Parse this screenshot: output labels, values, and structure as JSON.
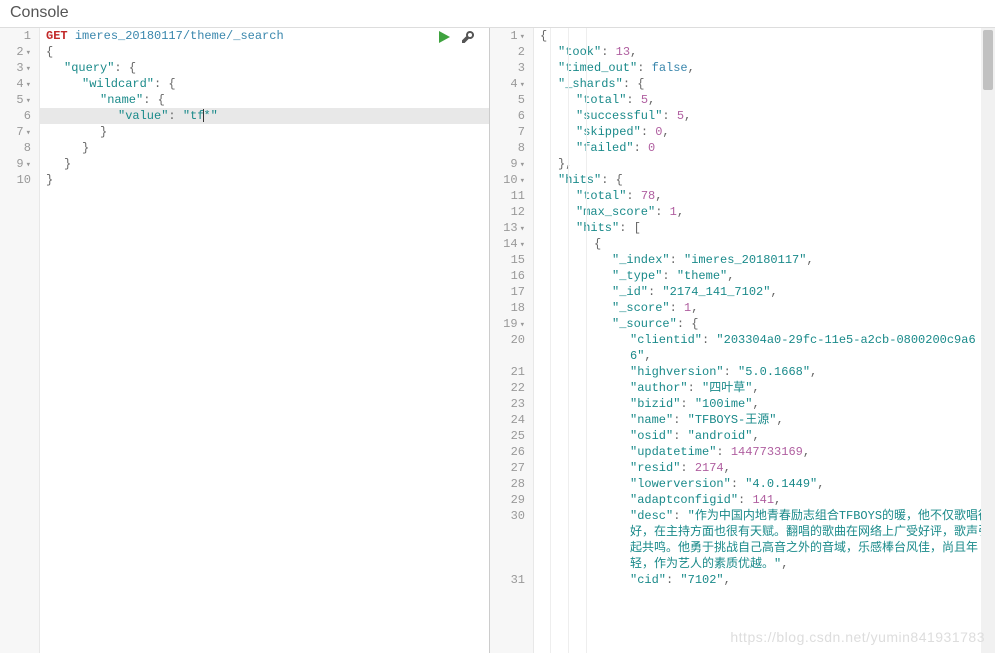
{
  "header": {
    "title": "Console"
  },
  "request": {
    "method": "GET",
    "path": "imeres_20180117/theme/_search",
    "lines": [
      {
        "n": 1,
        "type": "req"
      },
      {
        "n": 2,
        "fold": true,
        "raw": "{"
      },
      {
        "n": 3,
        "fold": true,
        "key": "query",
        "after": ": {"
      },
      {
        "n": 4,
        "fold": true,
        "key": "wildcard",
        "after": ": {"
      },
      {
        "n": 5,
        "fold": true,
        "key": "name",
        "after": ": {"
      },
      {
        "n": 6,
        "active": true,
        "key": "value",
        "val": "tf*",
        "valtype": "str_cursor"
      },
      {
        "n": 7,
        "fold": true,
        "raw": "}"
      },
      {
        "n": 8,
        "raw": "}"
      },
      {
        "n": 9,
        "fold": true,
        "raw": "}"
      },
      {
        "n": 10,
        "raw": "}"
      }
    ]
  },
  "toolbar": {
    "run": "run-button",
    "wrench": "settings-button"
  },
  "response": {
    "lines": [
      {
        "n": 1,
        "fold": true,
        "indent": 0,
        "raw": "{"
      },
      {
        "n": 2,
        "indent": 1,
        "key": "took",
        "val": "13",
        "t": "num"
      },
      {
        "n": 3,
        "indent": 1,
        "key": "timed_out",
        "val": "false",
        "t": "bool"
      },
      {
        "n": 4,
        "fold": true,
        "indent": 1,
        "key": "_shards",
        "after": ": {"
      },
      {
        "n": 5,
        "indent": 2,
        "key": "total",
        "val": "5",
        "t": "num"
      },
      {
        "n": 6,
        "indent": 2,
        "key": "successful",
        "val": "5",
        "t": "num"
      },
      {
        "n": 7,
        "indent": 2,
        "key": "skipped",
        "val": "0",
        "t": "num"
      },
      {
        "n": 8,
        "indent": 2,
        "key": "failed",
        "val": "0",
        "t": "num",
        "nocomma": true
      },
      {
        "n": 9,
        "fold": true,
        "indent": 1,
        "raw": "},"
      },
      {
        "n": 10,
        "fold": true,
        "indent": 1,
        "key": "hits",
        "after": ": {"
      },
      {
        "n": 11,
        "indent": 2,
        "key": "total",
        "val": "78",
        "t": "num"
      },
      {
        "n": 12,
        "indent": 2,
        "key": "max_score",
        "val": "1",
        "t": "num"
      },
      {
        "n": 13,
        "fold": true,
        "indent": 2,
        "key": "hits",
        "after": ": ["
      },
      {
        "n": 14,
        "fold": true,
        "indent": 3,
        "raw": "{"
      },
      {
        "n": 15,
        "indent": 4,
        "key": "_index",
        "val": "imeres_20180117",
        "t": "str"
      },
      {
        "n": 16,
        "indent": 4,
        "key": "_type",
        "val": "theme",
        "t": "str"
      },
      {
        "n": 17,
        "indent": 4,
        "key": "_id",
        "val": "2174_141_7102",
        "t": "str"
      },
      {
        "n": 18,
        "indent": 4,
        "key": "_score",
        "val": "1",
        "t": "num"
      },
      {
        "n": 19,
        "fold": true,
        "indent": 4,
        "key": "_source",
        "after": ": {"
      },
      {
        "n": 20,
        "indent": 5,
        "key": "clientid",
        "val": "203304a0-29fc-11e5-a2cb-0800200c9a66",
        "t": "str",
        "wrap": true
      },
      {
        "n": 21,
        "indent": 5,
        "key": "highversion",
        "val": "5.0.1668",
        "t": "str"
      },
      {
        "n": 22,
        "indent": 5,
        "key": "author",
        "val": "四叶草",
        "t": "str"
      },
      {
        "n": 23,
        "indent": 5,
        "key": "bizid",
        "val": "100ime",
        "t": "str"
      },
      {
        "n": 24,
        "indent": 5,
        "key": "name",
        "val": "TFBOYS-王源",
        "t": "str"
      },
      {
        "n": 25,
        "indent": 5,
        "key": "osid",
        "val": "android",
        "t": "str"
      },
      {
        "n": 26,
        "indent": 5,
        "key": "updatetime",
        "val": "1447733169",
        "t": "num"
      },
      {
        "n": 27,
        "indent": 5,
        "key": "resid",
        "val": "2174",
        "t": "num"
      },
      {
        "n": 28,
        "indent": 5,
        "key": "lowerversion",
        "val": "4.0.1449",
        "t": "str"
      },
      {
        "n": 29,
        "indent": 5,
        "key": "adaptconfigid",
        "val": "141",
        "t": "num"
      },
      {
        "n": 30,
        "indent": 5,
        "key": "desc",
        "val": "作为中国内地青春励志组合TFBOYS的暖，他不仅歌唱得好，在主持方面也很有天赋。翻唱的歌曲在网络上广受好评，歌声引起共鸣。他勇于挑战自己高音之外的音域，乐感棒台风佳，尚且年轻，作为艺人的素质优越。",
        "t": "str",
        "wrap": true
      },
      {
        "n": 31,
        "indent": 5,
        "key": "cid",
        "val": "7102",
        "t": "str"
      }
    ]
  },
  "watermark": "https://blog.csdn.net/yumin841931783"
}
